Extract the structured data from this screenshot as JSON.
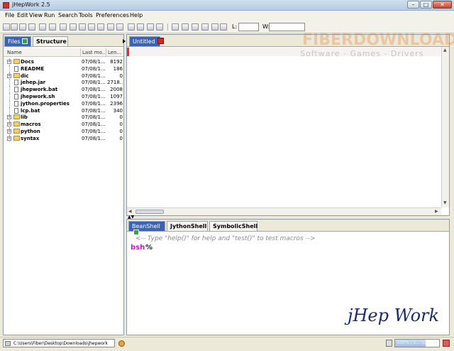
{
  "window": {
    "title": "jHepWork 2.5"
  },
  "menu": {
    "items": [
      "File",
      "Edit",
      "View",
      "Run",
      "Search",
      "Tools",
      "Preferences",
      "Help"
    ]
  },
  "toolbar": {
    "l_label": "L:",
    "w_label": "W:"
  },
  "watermark": {
    "title": "FIBERDOWNLOAD",
    "subtitle": "Software - Games - Drivers"
  },
  "left_panel": {
    "tabs": {
      "files": "Files",
      "structure": "Structure"
    },
    "columns": {
      "name": "Name",
      "modified": "Last mo...",
      "length": "Len..."
    },
    "rows": [
      {
        "name": "Docs",
        "date": "07/08/1...",
        "size": "8192",
        "kind": "folder"
      },
      {
        "name": "README",
        "date": "07/08/1...",
        "size": "186",
        "kind": "file"
      },
      {
        "name": "dic",
        "date": "07/08/1...",
        "size": "0",
        "kind": "folder"
      },
      {
        "name": "jehep.jar",
        "date": "07/08/1...",
        "size": "2718...",
        "kind": "file"
      },
      {
        "name": "jhepwork.bat",
        "date": "07/08/1...",
        "size": "2008",
        "kind": "file"
      },
      {
        "name": "jhepwork.sh",
        "date": "07/08/1...",
        "size": "1097",
        "kind": "file"
      },
      {
        "name": "jython.properties",
        "date": "07/08/1...",
        "size": "2396",
        "kind": "file"
      },
      {
        "name": "lcp.bat",
        "date": "07/08/1...",
        "size": "340",
        "kind": "file"
      },
      {
        "name": "lib",
        "date": "07/08/1...",
        "size": "0",
        "kind": "folder"
      },
      {
        "name": "macros",
        "date": "07/08/1...",
        "size": "0",
        "kind": "folder"
      },
      {
        "name": "python",
        "date": "07/08/1...",
        "size": "0",
        "kind": "folder"
      },
      {
        "name": "syntax",
        "date": "07/08/1...",
        "size": "0",
        "kind": "folder"
      }
    ]
  },
  "editor": {
    "tab_label": "Untitled"
  },
  "shell": {
    "tabs": {
      "beanshell": "BeanShell",
      "jythonshell": "JythonShell",
      "symbolicshell": "SymbolicShell"
    },
    "hint": "<-- Type \"help()\" for help and \"test()\" to test macros -->",
    "prompt_keyword": "bsh",
    "prompt_symbol": "%"
  },
  "brand": {
    "text": "jHep Work"
  },
  "status": {
    "path": "C:\\Users\\Fiber\\Desktop\\Downloads\\jhepwork",
    "memory_text": "100% / 2... 19/27M",
    "memory_fraction": 0.7
  },
  "icons": {
    "file_folder": "folder-icon",
    "file": "file-icon"
  }
}
